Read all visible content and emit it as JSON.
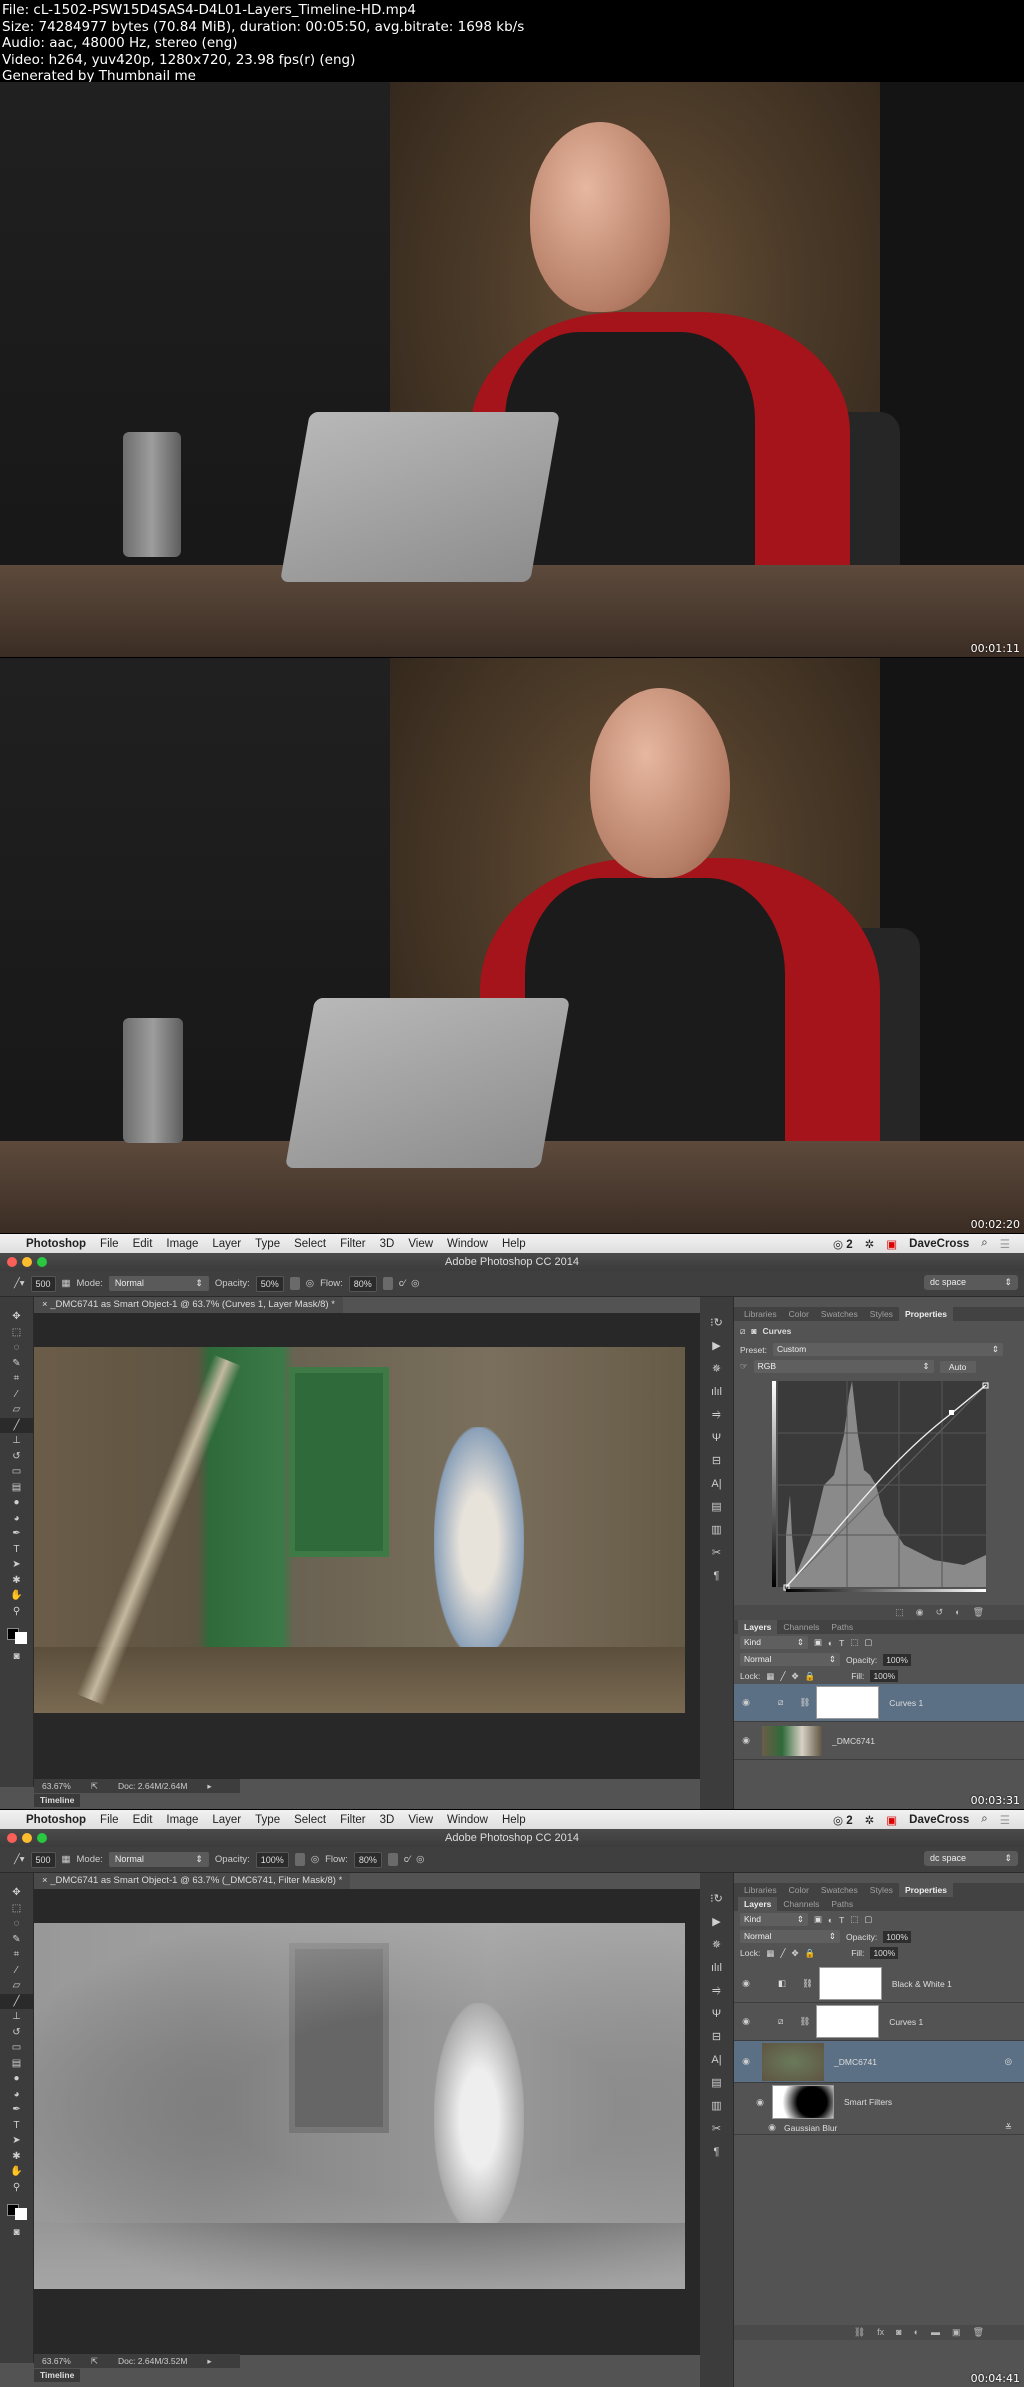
{
  "header": {
    "file": "File: cL-1502-PSW15D4SAS4-D4L01-Layers_Timeline-HD.mp4",
    "size": "Size: 74284977 bytes (70.84 MiB), duration: 00:05:50, avg.bitrate: 1698 kb/s",
    "audio": "Audio: aac, 48000 Hz, stereo (eng)",
    "video": "Video: h264, yuv420p, 1280x720, 23.98 fps(r) (eng)",
    "generator": "Generated by Thumbnail me"
  },
  "frames": [
    {
      "timestamp": "00:01:11"
    },
    {
      "timestamp": "00:02:20"
    },
    {
      "timestamp": "00:03:31",
      "menubar": {
        "items": [
          "Photoshop",
          "File",
          "Edit",
          "Image",
          "Layer",
          "Type",
          "Select",
          "Filter",
          "3D",
          "View",
          "Window",
          "Help"
        ],
        "cc_count": "2",
        "user": "DaveCross"
      },
      "window_title": "Adobe Photoshop CC 2014",
      "options": {
        "brush_size": "500",
        "mode_label": "Mode:",
        "mode": "Normal",
        "opacity_label": "Opacity:",
        "opacity": "50%",
        "flow_label": "Flow:",
        "flow": "80%",
        "workspace": "dc space"
      },
      "doc_tab": "_DMC6741 as Smart Object-1 @ 63.7% (Curves 1, Layer Mask/8) *",
      "status": {
        "zoom": "63.67%",
        "doc": "Doc: 2.64M/2.64M"
      },
      "timeline_label": "Timeline",
      "properties": {
        "tabs": [
          "Libraries",
          "Color",
          "Swatches",
          "Styles",
          "Properties"
        ],
        "active_tab": "Properties",
        "title": "Curves",
        "preset_label": "Preset:",
        "preset": "Custom",
        "channel": "RGB",
        "auto_label": "Auto"
      },
      "layers": {
        "tabs": [
          "Layers",
          "Channels",
          "Paths"
        ],
        "filter": "Kind",
        "blend": "Normal",
        "opacity_label": "Opacity:",
        "opacity": "100%",
        "lock_label": "Lock:",
        "fill_label": "Fill:",
        "fill": "100%",
        "items": [
          {
            "name": "Curves 1",
            "selected": true
          },
          {
            "name": "_DMC6741",
            "selected": false
          }
        ]
      }
    },
    {
      "timestamp": "00:04:41",
      "menubar": {
        "items": [
          "Photoshop",
          "File",
          "Edit",
          "Image",
          "Layer",
          "Type",
          "Select",
          "Filter",
          "3D",
          "View",
          "Window",
          "Help"
        ],
        "cc_count": "2",
        "user": "DaveCross"
      },
      "window_title": "Adobe Photoshop CC 2014",
      "options": {
        "brush_size": "500",
        "mode_label": "Mode:",
        "mode": "Normal",
        "opacity_label": "Opacity:",
        "opacity": "100%",
        "flow_label": "Flow:",
        "flow": "80%",
        "workspace": "dc space"
      },
      "doc_tab": "_DMC6741 as Smart Object-1 @ 63.7% (_DMC6741, Filter Mask/8) *",
      "status": {
        "zoom": "63.67%",
        "doc": "Doc: 2.64M/3.52M"
      },
      "timeline_label": "Timeline",
      "properties": {
        "tabs": [
          "Libraries",
          "Color",
          "Swatches",
          "Styles",
          "Properties"
        ],
        "active_tab": "Properties"
      },
      "layers": {
        "tabs": [
          "Layers",
          "Channels",
          "Paths"
        ],
        "filter": "Kind",
        "blend": "Normal",
        "opacity_label": "Opacity:",
        "opacity": "100%",
        "lock_label": "Lock:",
        "fill_label": "Fill:",
        "fill": "100%",
        "items": [
          {
            "name": "Black & White 1",
            "selected": false
          },
          {
            "name": "Curves 1",
            "selected": false
          },
          {
            "name": "_DMC6741",
            "selected": true
          },
          {
            "name": "Smart Filters",
            "selected": false
          },
          {
            "name": "Gaussian Blur",
            "selected": false
          }
        ]
      }
    }
  ],
  "colors": {
    "ps_bg": "#535353",
    "selected_layer": "#5c7085",
    "menubar": "#e8e8e8"
  }
}
